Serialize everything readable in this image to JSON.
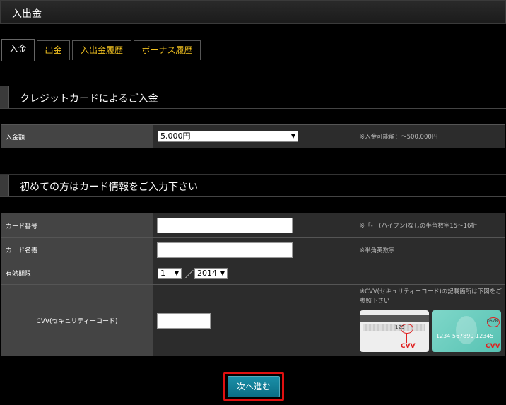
{
  "header": {
    "title": "入出金"
  },
  "tabs": [
    {
      "label": "入金"
    },
    {
      "label": "出金"
    },
    {
      "label": "入出金履歴"
    },
    {
      "label": "ボーナス履歴"
    }
  ],
  "section1": {
    "title": "クレジットカードによるご入金"
  },
  "deposit": {
    "label": "入金額",
    "selected": "5,000円",
    "note": "※入金可能額：～500,000円"
  },
  "section2": {
    "title": "初めての方はカード情報をご入力下さい"
  },
  "card_form": {
    "number": {
      "label": "カード番号",
      "value": "",
      "note": "※「-」(ハイフン)なしの半角数字15～16桁"
    },
    "name": {
      "label": "カード名義",
      "value": "",
      "note": "※半角英数字"
    },
    "expiry": {
      "label": "有効期限",
      "month": "1",
      "separator": "／",
      "year": "2014"
    },
    "cvv": {
      "label": "CVV(セキュリティーコード)",
      "value": "",
      "note": "※CVV(セキュリティーコード)の記載箇所は下図をご参照下さい",
      "img1": {
        "cvv_text": "CVV",
        "code": "123"
      },
      "img2": {
        "cvv_text": "CVV",
        "number_text": "1234 567890 12345",
        "code": "0678"
      }
    }
  },
  "submit": {
    "label": "次へ進む"
  },
  "colors": {
    "tab_text": "#f0c020",
    "button": "#0c6f86",
    "highlight": "#e01010"
  }
}
